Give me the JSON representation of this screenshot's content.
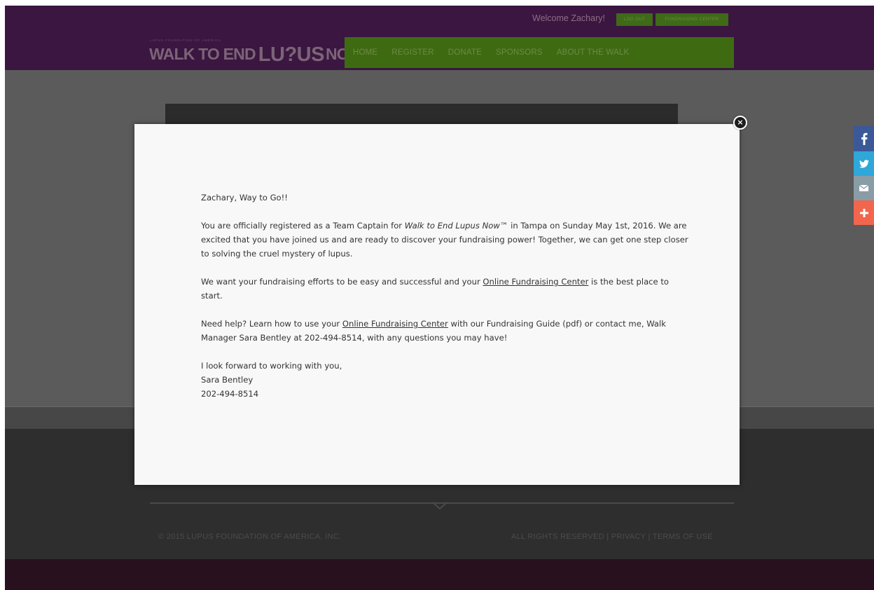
{
  "header": {
    "welcome": "Welcome Zachary!",
    "logout_label": "LOG OUT",
    "fundraising_center_label": "FUNDRAISING CENTER",
    "logo_tagline": "LUPUS FOUNDATION OF AMERICA",
    "logo_walk": "WALK TO END",
    "logo_lupus": "LU?US",
    "logo_now": "NOW"
  },
  "nav": {
    "items": [
      {
        "label": "HOME"
      },
      {
        "label": "REGISTER"
      },
      {
        "label": "DONATE"
      },
      {
        "label": "SPONSORS"
      },
      {
        "label": "ABOUT THE WALK"
      }
    ]
  },
  "modal": {
    "greeting": "Zachary, Way to Go!!",
    "p1_before": "You are officially registered as a Team Captain for ",
    "p1_event": "Walk to End Lupus Now™",
    "p1_after": " in Tampa on Sunday May 1st, 2016. We are excited that you have joined us and are ready to discover your fundraising power! Together, we can get one step closer to solving the cruel mystery of lupus.",
    "p2_before": "We want your fundraising efforts to be easy and successful and your ",
    "p2_link": "Online Fundraising Center",
    "p2_after": " is the best place to start.",
    "p3_before": "Need help? Learn how to use your ",
    "p3_link": "Online Fundraising Center",
    "p3_after": " with our Fundraising Guide (pdf) or contact me, Walk Manager Sara Bentley at 202-494-8514, with any questions you may have!",
    "closing": "I look forward to working with you,",
    "signer_name": "Sara Bentley",
    "signer_phone": "202-494-8514",
    "close_symbol": "×"
  },
  "footer": {
    "copyright": "© 2015 LUPUS FOUNDATION OF AMERICA, INC.",
    "links": "ALL RIGHTS RESERVED | PRIVACY | TERMS OF USE"
  },
  "share": {
    "icons": [
      "facebook-icon",
      "twitter-icon",
      "email-icon",
      "plus-icon"
    ]
  },
  "colors": {
    "header_purple": "#3a1640",
    "nav_green": "#3e6b12",
    "facebook": "#3b5998",
    "twitter": "#2fa7d8",
    "email": "#8a9da6",
    "more": "#f2664d"
  }
}
